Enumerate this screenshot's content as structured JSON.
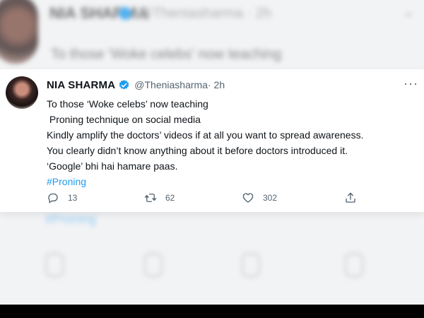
{
  "background_tweet": {
    "name": "NIA SHARMA",
    "handle": "@Theniasharma · 2h",
    "text": "To those 'Woke celebs' now teaching",
    "hashtag": "#Proning"
  },
  "tweet": {
    "name": "NIA SHARMA",
    "handle": "@Theniasharma",
    "time": " · 2h",
    "lines": [
      "To those ‘Woke celebs’ now teaching",
      " Proning technique on social media",
      "Kindly amplify the doctors’ videos if at all you want to spread awareness.",
      "You clearly didn’t know anything about it before doctors introduced it.",
      "‘Google’ bhi hai hamare paas."
    ],
    "hashtag": "#Proning",
    "more_icon": "more-horizontal-icon",
    "verified_icon": "verified-badge-icon"
  },
  "actions": {
    "reply": {
      "icon": "reply-icon",
      "count": "13"
    },
    "retweet": {
      "icon": "retweet-icon",
      "count": "62"
    },
    "like": {
      "icon": "heart-icon",
      "count": "302"
    },
    "share": {
      "icon": "share-icon"
    }
  },
  "colors": {
    "accent": "#1d9bf0",
    "text": "#0f1419",
    "secondary": "#536471"
  }
}
